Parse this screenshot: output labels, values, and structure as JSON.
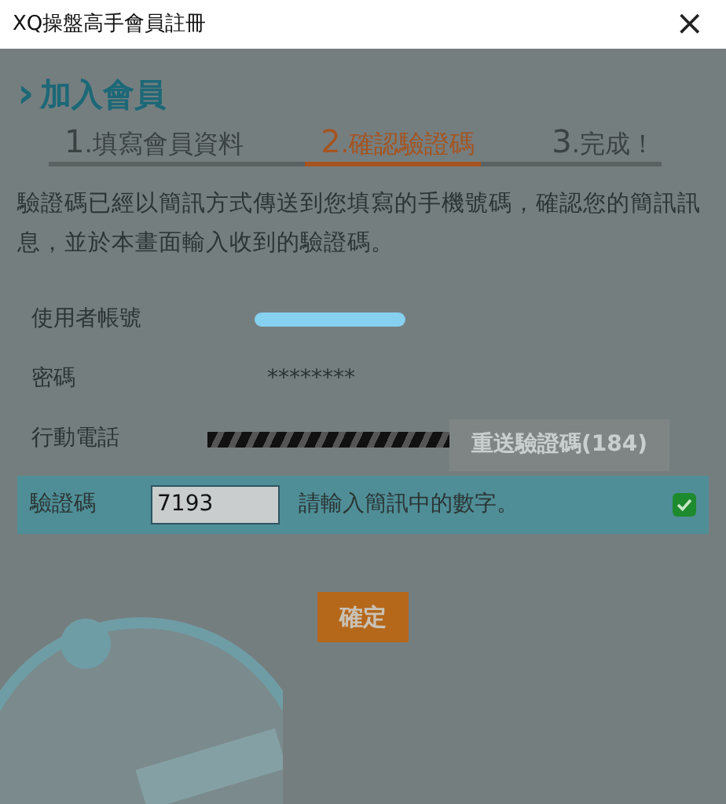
{
  "window": {
    "title": "XQ操盤高手會員註冊",
    "close": "×"
  },
  "heading": {
    "arrow": "›",
    "text": "加入會員"
  },
  "steps": [
    {
      "number": "1",
      "label": ".填寫會員資料",
      "selected": false
    },
    {
      "number": "2",
      "label": ".確認驗證碼",
      "selected": true
    },
    {
      "number": "3",
      "label": ".完成！",
      "selected": false
    }
  ],
  "message": "驗證碼已經以簡訊方式傳送到您填寫的手機號碼，確認您的簡訊訊息，並於本畫面輸入收到的驗證碼。",
  "fields": [
    {
      "kind": "redacted-pill",
      "label": "使用者帳號"
    },
    {
      "kind": "text",
      "label": "密碼",
      "value": "********"
    },
    {
      "kind": "redacted-stripes",
      "label": "行動電話",
      "button": {
        "label": "重送驗證碼(184)",
        "disabled": true
      }
    }
  ],
  "verification": {
    "label": "驗證碼",
    "value": "7193",
    "hint": "請輸入簡訊中的數字。",
    "valid": true
  },
  "confirm": "確定"
}
